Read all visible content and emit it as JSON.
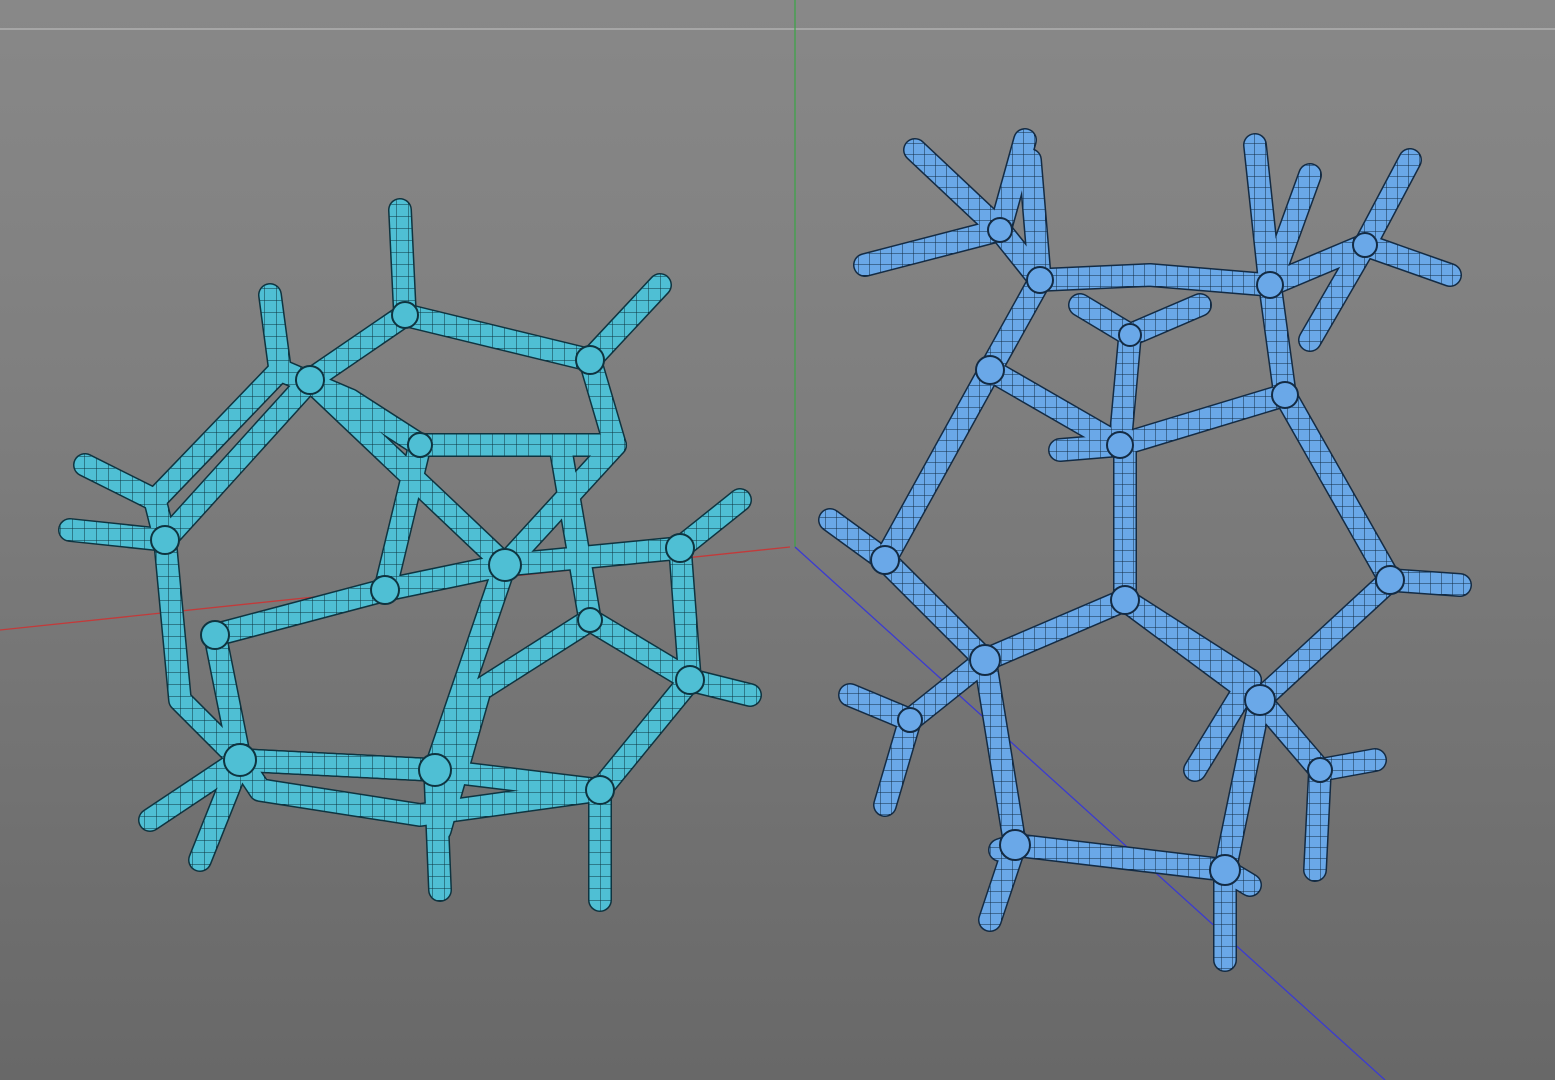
{
  "viewport": {
    "background": "#7c7c7c",
    "axis_colors": {
      "x_axis": "#c33a3a",
      "y_axis": "#3fa34a",
      "z_axis": "#3b3bd0"
    }
  },
  "objects": [
    {
      "shape": "dodecahedron-wireframe",
      "color": "#46b6cc",
      "wire_color": "#0d2f38"
    },
    {
      "shape": "open-cage-wireframe",
      "color": "#5f9ee0",
      "wire_color": "#10263f"
    }
  ]
}
